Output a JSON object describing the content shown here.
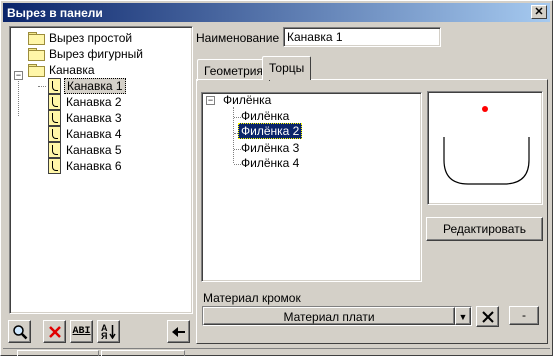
{
  "window": {
    "title": "Вырез в панели",
    "close_glyph": "✕"
  },
  "left_tree": {
    "items": [
      {
        "label": "Вырез простой",
        "icon": "folder-icon",
        "level": 0
      },
      {
        "label": "Вырез фигурный",
        "icon": "folder-icon",
        "level": 0
      },
      {
        "label": "Канавка",
        "icon": "folder-open-icon",
        "level": 0,
        "expander": "−"
      },
      {
        "label": "Канавка 1",
        "icon": "groove-icon",
        "level": 1,
        "selected": true
      },
      {
        "label": "Канавка 2",
        "icon": "groove-icon",
        "level": 1
      },
      {
        "label": "Канавка 3",
        "icon": "groove-icon",
        "level": 1
      },
      {
        "label": "Канавка 4",
        "icon": "groove-icon",
        "level": 1
      },
      {
        "label": "Канавка 5",
        "icon": "groove-icon",
        "level": 1
      },
      {
        "label": "Канавка 6",
        "icon": "groove-icon",
        "level": 1
      }
    ]
  },
  "toolbar": {
    "buttons": [
      {
        "name": "search-button",
        "icon": "magnifier-icon"
      },
      {
        "name": "delete-button",
        "icon": "red-x-icon"
      },
      {
        "name": "rename-button",
        "icon": "rename-icon",
        "glyph": "ABI"
      },
      {
        "name": "sort-button",
        "icon": "sort-az-icon",
        "glyph": "AЯ"
      },
      {
        "name": "back-button",
        "icon": "arrow-left-icon"
      }
    ]
  },
  "form": {
    "name_label": "Наименование",
    "name_value": "Канавка 1"
  },
  "tabs": [
    {
      "label": "Геометрия",
      "active": false
    },
    {
      "label": "Торцы",
      "active": true
    }
  ],
  "inner_tree": {
    "root": {
      "label": "Филёнка",
      "expander": "−"
    },
    "children": [
      {
        "label": "Филёнка",
        "selected": false
      },
      {
        "label": "Филёнка 2",
        "selected": true
      },
      {
        "label": "Филёнка 3",
        "selected": false
      },
      {
        "label": "Филёнка 4",
        "selected": false
      }
    ]
  },
  "preview": {
    "marker_color": "#ff0000",
    "outline_color": "#000000"
  },
  "edit_button": {
    "label": "Редактировать"
  },
  "material": {
    "label": "Материал кромок",
    "value": "Материал плати",
    "extra_value": "-"
  }
}
